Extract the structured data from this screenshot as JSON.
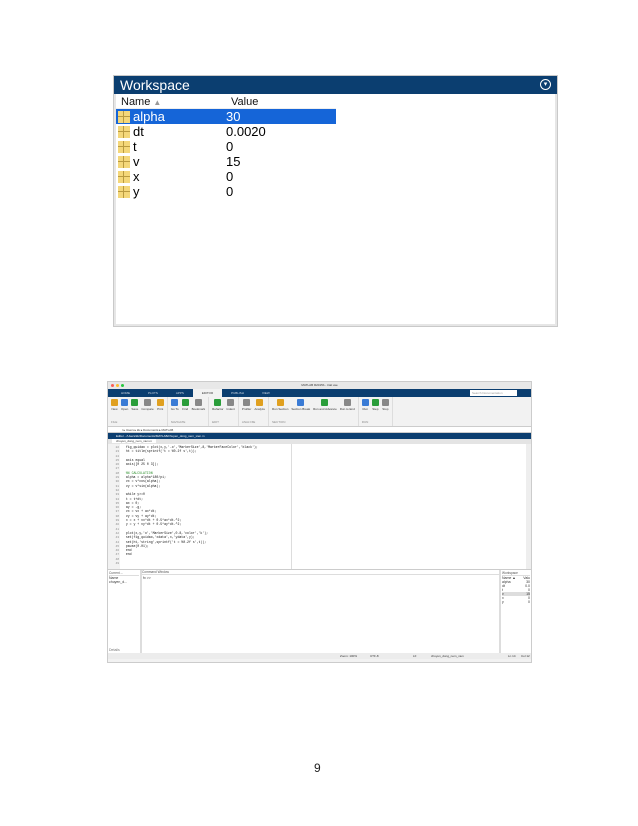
{
  "workspace": {
    "title": "Workspace",
    "col_name": "Name",
    "sort_indicator": "▲",
    "col_value": "Value",
    "vars": [
      {
        "name": "alpha",
        "value": "30"
      },
      {
        "name": "dt",
        "value": "0.0020"
      },
      {
        "name": "t",
        "value": "0"
      },
      {
        "name": "v",
        "value": "15"
      },
      {
        "name": "x",
        "value": "0"
      },
      {
        "name": "y",
        "value": "0"
      }
    ]
  },
  "matlab": {
    "window_title": "MATLAB R2015b - trial use",
    "tabs": [
      "HOME",
      "PLOTS",
      "APPS",
      "EDITOR",
      "PUBLISH",
      "VIEW"
    ],
    "search_placeholder": "Search Documentation",
    "toolstrip": [
      {
        "group": "FILE",
        "buttons": [
          "New",
          "Open",
          "Save",
          "Compare",
          "Print"
        ]
      },
      {
        "group": "NAVIGATE",
        "buttons": [
          "Go To",
          "Find",
          "Bookmark"
        ]
      },
      {
        "group": "EDIT",
        "buttons": [
          "Refactor",
          "Indent"
        ]
      },
      {
        "group": "ANALYZE",
        "buttons": [
          "Profiler",
          "Analyze"
        ]
      },
      {
        "group": "SECTION",
        "buttons": [
          "Run Section",
          "Section Break",
          "Run and Advance",
          "Run to End"
        ]
      },
      {
        "group": "RUN",
        "buttons": [
          "Run",
          "Step",
          "Stop"
        ]
      }
    ],
    "path": "/ ▸ Users ▸ kk ▸ Documents ▸ MATLAB",
    "editor_title": "Editor - /Users/kk/Documents/MATLAB/chuyen_dong_nem_xien.m",
    "file_tab": "chuyen_dong_nem_xien.m",
    "line_numbers": [
      "22",
      "23",
      "24",
      "25",
      "26",
      "27",
      "28",
      "29",
      "30",
      "31",
      "32",
      "33",
      "34",
      "35",
      "36",
      "37",
      "38",
      "39",
      "40",
      "41",
      "42",
      "43",
      "44",
      "45",
      "46",
      "47",
      "48",
      "49"
    ],
    "code_lines": [
      "  fig_quidao = plot(x,y,'-o','MarkerSize',8,'MarkerFaceColor','black');",
      "  ht = title(sprintf('t = %0.2f s',t));",
      "",
      "  axis equal",
      "  axis([0 25 0 3]);",
      "",
      "  %% CALCULATION",
      "  alpha = alpha*180/pi;",
      "  vx = v*cos(alpha);",
      "  vy = v*sin(alpha);",
      "",
      "  while y>=0",
      "  t = t+dt;",
      "  ax = 0;",
      "  ay = -g;",
      "  vx = vx + ax*dt;",
      "  vy = vy + ay*dt;",
      "  x = x + vx*dt + 0.5*ax*dt.^2;",
      "  y = y + vy*dt + 0.5*ay*dt.^2;",
      "",
      "  plot(x,y,'o','MarkerSize',0.8,'color','k');",
      "  set(fig_quidao,'xdata',x,'ydata',y);",
      "  set(ht,'string',sprintf('t = %0.2f s',t));",
      "  pause(0.01);",
      "  end",
      "  end",
      "",
      ""
    ],
    "current_folder": {
      "title": "Current ...",
      "col": "Name",
      "file": "chuyen_d...",
      "details": "Details"
    },
    "command_window": {
      "title": "Command Window",
      "prompt": "fx >>"
    },
    "mini_workspace": {
      "title": "Workspace",
      "col": "Name ▲",
      "col_value": "Valu",
      "vars": [
        [
          "alpha",
          "30"
        ],
        [
          "dt",
          "0.0"
        ],
        [
          "t",
          "0"
        ],
        [
          "v",
          "15"
        ],
        [
          "x",
          "0"
        ],
        [
          "y",
          "0"
        ]
      ]
    },
    "status": {
      "zoom": "Zoom: 100%",
      "encoding": "UTF-8",
      "eol": "LF",
      "script": "chuyen_dong_nem_xien",
      "ln": "Ln 14",
      "col": "Col 12"
    }
  },
  "page_number": "9"
}
